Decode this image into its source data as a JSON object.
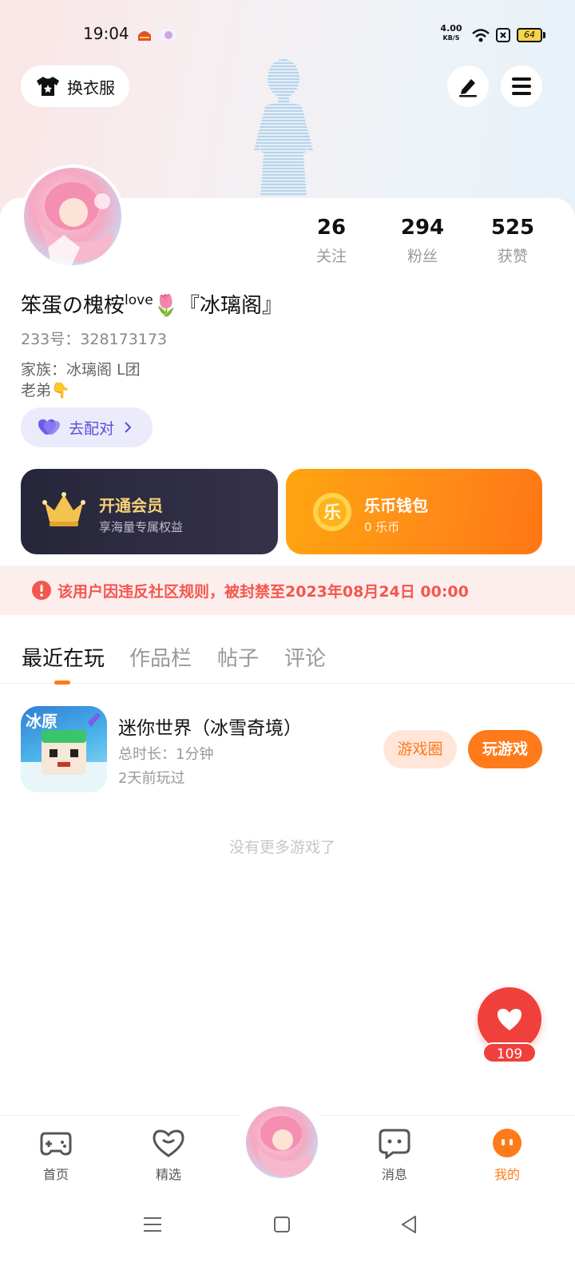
{
  "status_bar": {
    "time": "19:04",
    "net_speed": "4.00",
    "net_unit": "KB/S",
    "battery": "64"
  },
  "header": {
    "dress_button_label": "换衣服"
  },
  "profile": {
    "stats": [
      {
        "value": "26",
        "label": "关注"
      },
      {
        "value": "294",
        "label": "粉丝"
      },
      {
        "value": "525",
        "label": "获赞"
      }
    ],
    "nickname_main": "笨蛋の槐桉",
    "nickname_sup": "love",
    "nickname_tail": "🌷『冰璃阁』",
    "uid": "233号：328173173",
    "family": "家族：冰璃阁 L团",
    "bio": "老弟👇",
    "pair_button_label": "去配对"
  },
  "cards": {
    "vip_title": "开通会员",
    "vip_subtitle": "享海量专属权益",
    "wallet_title": "乐币钱包",
    "wallet_subtitle": "0 乐币",
    "wallet_coin_char": "乐"
  },
  "ban_notice": "该用户因违反社区规则，被封禁至2023年08月24日 00:00",
  "tabs": [
    {
      "label": "最近在玩"
    },
    {
      "label": "作品栏"
    },
    {
      "label": "帖子"
    },
    {
      "label": "评论"
    }
  ],
  "games": [
    {
      "title": "迷你世界（冰雪奇境）",
      "duration": "总时长：1分钟",
      "last_played": "2天前玩过",
      "icon_text": "冰原",
      "circle_label": "游戏圈",
      "play_label": "玩游戏"
    }
  ],
  "no_more_text": "没有更多游戏了",
  "favorite_count": "109",
  "bottom_nav": [
    {
      "label": "首页"
    },
    {
      "label": "精选"
    },
    {
      "label": "消息"
    },
    {
      "label": "我的"
    }
  ],
  "colors": {
    "accent": "#ff7a1a",
    "ban_text": "#f2574e",
    "vip_gold": "#f6d27a"
  }
}
